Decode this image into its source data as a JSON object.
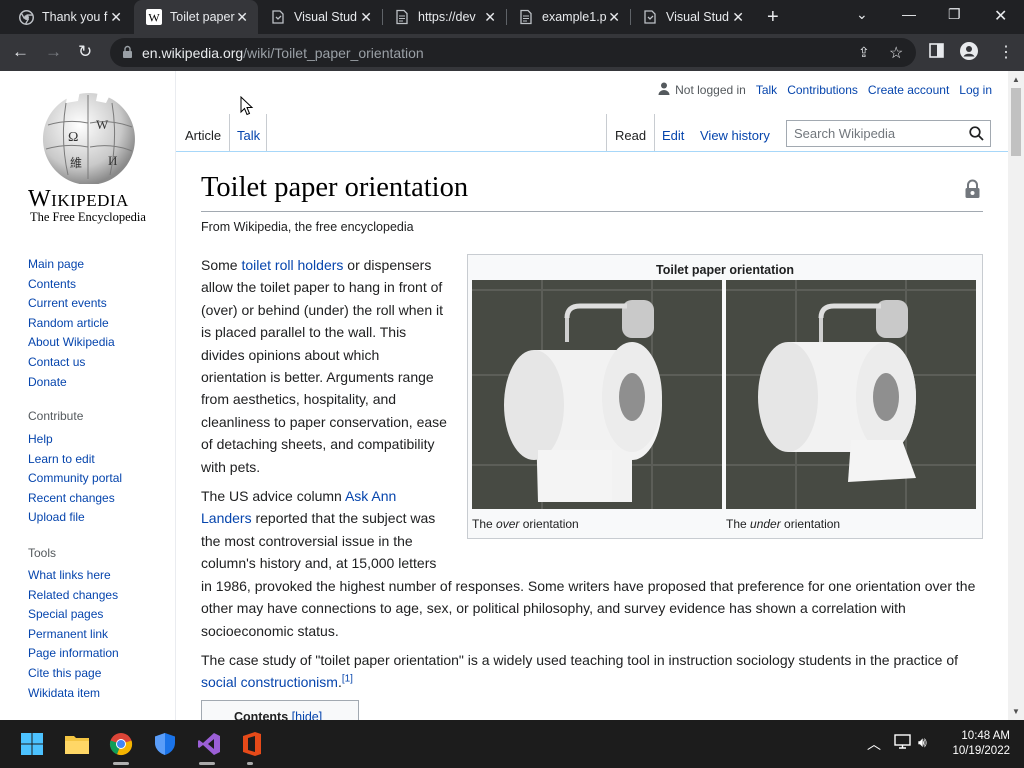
{
  "browser": {
    "tabs": [
      {
        "title": "Thank you f",
        "icon": "chrome-icon"
      },
      {
        "title": "Toilet paper",
        "icon": "wikipedia-icon"
      },
      {
        "title": "Visual Stud",
        "icon": "vs-doc-icon"
      },
      {
        "title": "https://dev",
        "icon": "doc-icon"
      },
      {
        "title": "example1.p",
        "icon": "doc-icon"
      },
      {
        "title": "Visual Stud",
        "icon": "vs-doc-icon"
      }
    ],
    "url_host": "en.wikipedia.org",
    "url_path": "/wiki/Toilet_paper_orientation"
  },
  "wiki": {
    "wordmark": "Wikipedia",
    "tagline": "The Free Encyclopedia",
    "nav_main": [
      "Main page",
      "Contents",
      "Current events",
      "Random article",
      "About Wikipedia",
      "Contact us",
      "Donate"
    ],
    "contribute_heading": "Contribute",
    "nav_contribute": [
      "Help",
      "Learn to edit",
      "Community portal",
      "Recent changes",
      "Upload file"
    ],
    "tools_heading": "Tools",
    "nav_tools": [
      "What links here",
      "Related changes",
      "Special pages",
      "Permanent link",
      "Page information",
      "Cite this page",
      "Wikidata item"
    ],
    "user": {
      "not_logged_in": "Not logged in",
      "talk": "Talk",
      "contributions": "Contributions",
      "create_account": "Create account",
      "log_in": "Log in"
    },
    "tabs": {
      "article": "Article",
      "talk": "Talk",
      "read": "Read",
      "edit": "Edit",
      "history": "View history"
    },
    "search_placeholder": "Search Wikipedia",
    "title": "Toilet paper orientation",
    "from": "From Wikipedia, the free encyclopedia",
    "infobox": {
      "title": "Toilet paper orientation",
      "cap1_pre": "The ",
      "cap1_em": "over",
      "cap1_post": " orientation",
      "cap2_pre": "The ",
      "cap2_em": "under",
      "cap2_post": " orientation"
    },
    "p1": {
      "a": "Some ",
      "link": "toilet roll holders",
      "b": " or dispensers allow the toilet paper to hang in front of (over) or behind (under) the roll when it is placed parallel to the wall. This divides opinions about which orientation is better. Arguments range from aesthetics, hospitality, and cleanliness to paper conservation, ease of detaching sheets, and compatibility with pets."
    },
    "p2": {
      "a": "The US advice column ",
      "link": "Ask Ann Landers",
      "b": " reported that the subject was the most controversial issue in the column's history and, at 15,000 letters in 1986, provoked the highest number of responses. Some writers have proposed that preference for one orientation over the other may have connections to age, sex, or political philosophy, and survey evidence has shown a correlation with socioeconomic status."
    },
    "p3": {
      "a": "The case study of \"toilet paper orientation\" is a widely used teaching tool in instruction sociology students in the practice of ",
      "link": "social constructionism",
      "b": ".",
      "ref": "[1]"
    },
    "contents_title": "Contents",
    "contents_hide": "[hide]"
  },
  "taskbar": {
    "time": "10:48 AM",
    "date": "10/19/2022"
  }
}
